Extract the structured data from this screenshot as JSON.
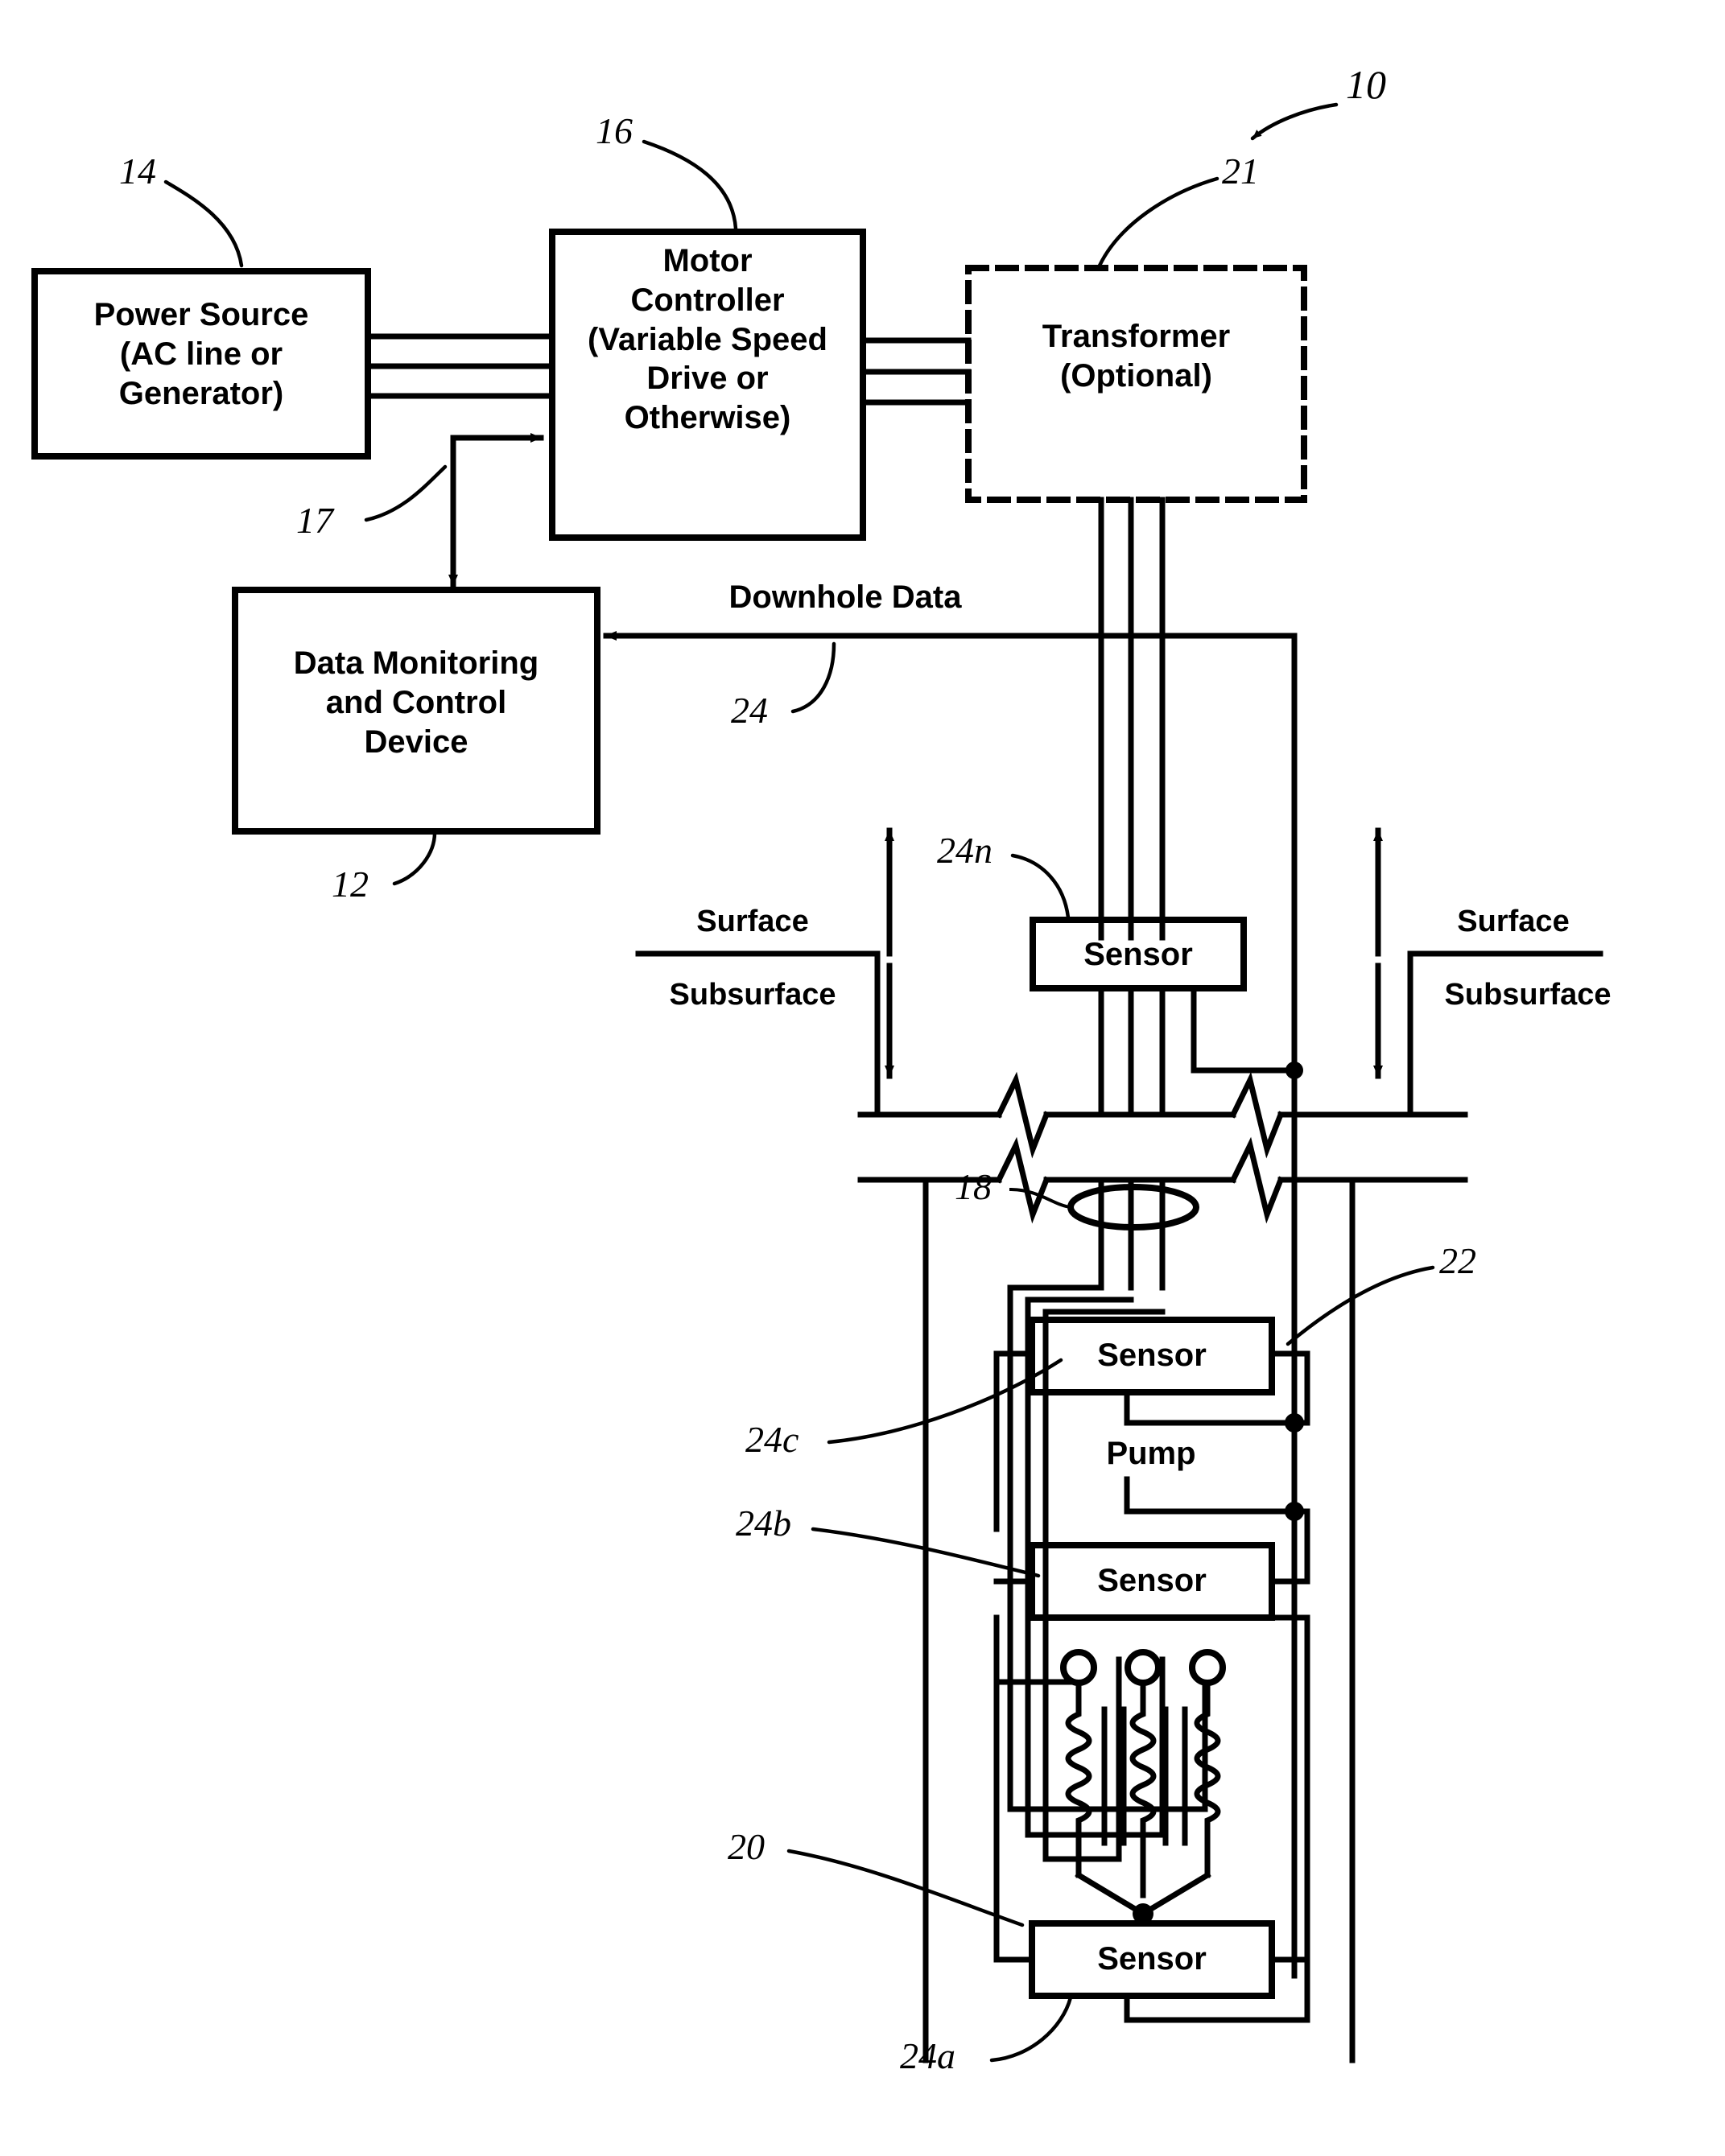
{
  "figure": {
    "kind": "patent-figure",
    "system_reference": "10"
  },
  "blocks": {
    "power_source": {
      "label": "Power Source\n(AC line or\nGenerator)",
      "ref": "14"
    },
    "motor_controller": {
      "label": "Motor\nController\n(Variable Speed\nDrive or\nOtherwise)",
      "ref": "16"
    },
    "transformer": {
      "label": "Transformer\n(Optional)",
      "ref": "21"
    },
    "data_monitoring": {
      "label": "Data Monitoring\nand Control\nDevice",
      "ref": "12"
    },
    "control_link": {
      "ref": "17"
    }
  },
  "downhole": {
    "data_label": "Downhole Data",
    "data_ref": "24",
    "surface_left": "Surface",
    "subsurface_left": "Subsurface",
    "surface_right": "Surface",
    "subsurface_right": "Subsurface",
    "pump_label": "Pump",
    "pump_ref": "22",
    "cable_ref": "18",
    "motor_ref": "20",
    "sensors": [
      {
        "label": "Sensor",
        "ref": "24n",
        "position": "surface-wellhead"
      },
      {
        "label": "Sensor",
        "ref": "24c",
        "position": "above-pump"
      },
      {
        "label": "Sensor",
        "ref": "24b",
        "position": "below-pump"
      },
      {
        "label": "Sensor",
        "ref": "24a",
        "position": "below-motor"
      }
    ]
  },
  "colors": {
    "ink": "#000000",
    "paper": "#ffffff"
  }
}
